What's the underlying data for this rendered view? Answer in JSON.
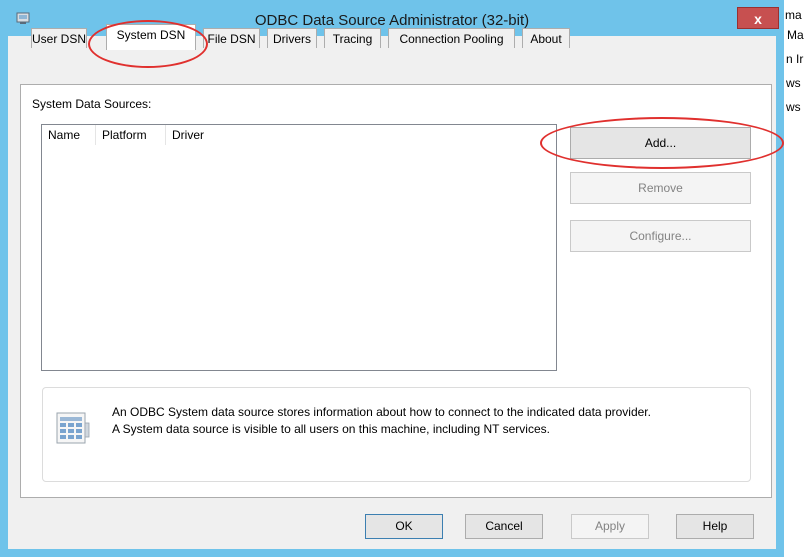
{
  "window": {
    "title": "ODBC Data Source Administrator (32-bit)",
    "close_label": "x"
  },
  "background_window": {
    "fragments": [
      "ma",
      "Ma",
      "n Ir",
      "ws",
      "ws"
    ]
  },
  "tabs": [
    {
      "label": "User DSN",
      "active": false
    },
    {
      "label": "System DSN",
      "active": true
    },
    {
      "label": "File DSN",
      "active": false
    },
    {
      "label": "Drivers",
      "active": false
    },
    {
      "label": "Tracing",
      "active": false
    },
    {
      "label": "Connection Pooling",
      "active": false
    },
    {
      "label": "About",
      "active": false
    }
  ],
  "system_dsn": {
    "section_label": "System Data Sources:",
    "columns": [
      "Name",
      "Platform",
      "Driver"
    ],
    "rows": [],
    "buttons": {
      "add": "Add...",
      "remove": "Remove",
      "configure": "Configure..."
    },
    "info_lines": [
      "An ODBC System data source stores information about how to connect to the indicated data provider.",
      "A System data source is visible to all users on this machine, including NT services."
    ]
  },
  "footer_buttons": {
    "ok": "OK",
    "cancel": "Cancel",
    "apply": "Apply",
    "help": "Help"
  },
  "colors": {
    "title_bar": "#6fc3ea",
    "close_button": "#c75050",
    "annotation_ring": "#e0302e"
  }
}
